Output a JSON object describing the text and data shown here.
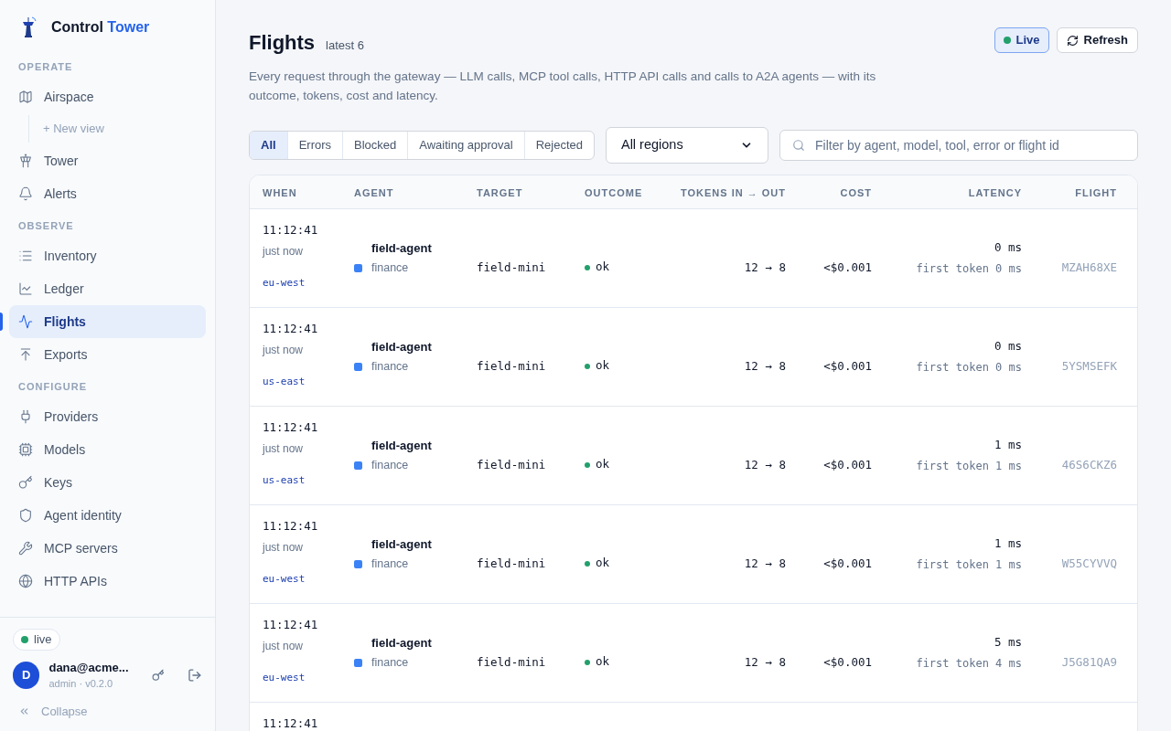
{
  "brand": {
    "first": "Control",
    "second": "Tower"
  },
  "sidebar": {
    "sections": [
      {
        "title": "OPERATE",
        "items": [
          {
            "label": "Airspace",
            "selected": false,
            "children": [
              {
                "label": "+ New view",
                "selected": false
              }
            ]
          },
          {
            "label": "Tower",
            "selected": false
          },
          {
            "label": "Alerts",
            "selected": false
          }
        ]
      },
      {
        "title": "OBSERVE",
        "items": [
          {
            "label": "Inventory",
            "selected": false
          },
          {
            "label": "Ledger",
            "selected": false
          },
          {
            "label": "Flights",
            "selected": true
          },
          {
            "label": "Exports",
            "selected": false
          }
        ]
      },
      {
        "title": "CONFIGURE",
        "items": [
          {
            "label": "Providers",
            "selected": false
          },
          {
            "label": "Models",
            "selected": false
          },
          {
            "label": "Keys",
            "selected": false
          },
          {
            "label": "Agent identity",
            "selected": false
          },
          {
            "label": "MCP servers",
            "selected": false
          },
          {
            "label": "HTTP APIs",
            "selected": false
          }
        ]
      }
    ],
    "status": {
      "label": "live",
      "color": "#22a06b"
    },
    "user": {
      "initial": "D",
      "email": "dana@acme...",
      "role": "admin · v0.2.0"
    },
    "collapse": "Collapse"
  },
  "page": {
    "title": "Flights",
    "count": "latest 6",
    "description": "Every request through the gateway — LLM calls, MCP tool calls, HTTP API calls and calls to A2A agents — with its outcome, tokens, cost and latency.",
    "live": {
      "label": "Live",
      "on": true,
      "color": "#22a06b"
    },
    "refresh": "Refresh"
  },
  "filters": [
    {
      "label": "All",
      "selected": true
    },
    {
      "label": "Errors",
      "selected": false
    },
    {
      "label": "Blocked",
      "selected": false
    },
    {
      "label": "Awaiting approval",
      "selected": false
    },
    {
      "label": "Rejected",
      "selected": false
    }
  ],
  "region": {
    "value": "All regions"
  },
  "search": {
    "placeholder": "Filter by agent, model, tool, error or flight id"
  },
  "table": {
    "columns": [
      "WHEN",
      "AGENT",
      "TARGET",
      "OUTCOME",
      "TOKENS IN → OUT",
      "COST",
      "LATENCY",
      "FLIGHT"
    ],
    "rows": [
      {
        "time": "11:12:41",
        "ago": "just now",
        "region": "eu-west",
        "agent": "field-agent",
        "team": "finance",
        "color": "#3b82f6",
        "target": "field-mini",
        "outcome": {
          "label": "ok",
          "color": "#22a06b"
        },
        "tokens": "12 → 8",
        "cost": "<$0.001",
        "latency": "0 ms",
        "first_token": "first token 0 ms",
        "flight": "MZAH68XE"
      },
      {
        "time": "11:12:41",
        "ago": "just now",
        "region": "us-east",
        "agent": "field-agent",
        "team": "finance",
        "color": "#3b82f6",
        "target": "field-mini",
        "outcome": {
          "label": "ok",
          "color": "#22a06b"
        },
        "tokens": "12 → 8",
        "cost": "<$0.001",
        "latency": "0 ms",
        "first_token": "first token 0 ms",
        "flight": "5YSMSEFK"
      },
      {
        "time": "11:12:41",
        "ago": "just now",
        "region": "us-east",
        "agent": "field-agent",
        "team": "finance",
        "color": "#3b82f6",
        "target": "field-mini",
        "outcome": {
          "label": "ok",
          "color": "#22a06b"
        },
        "tokens": "12 → 8",
        "cost": "<$0.001",
        "latency": "1 ms",
        "first_token": "first token 1 ms",
        "flight": "46S6CKZ6"
      },
      {
        "time": "11:12:41",
        "ago": "just now",
        "region": "eu-west",
        "agent": "field-agent",
        "team": "finance",
        "color": "#3b82f6",
        "target": "field-mini",
        "outcome": {
          "label": "ok",
          "color": "#22a06b"
        },
        "tokens": "12 → 8",
        "cost": "<$0.001",
        "latency": "1 ms",
        "first_token": "first token 1 ms",
        "flight": "W55CYVVQ"
      },
      {
        "time": "11:12:41",
        "ago": "just now",
        "region": "eu-west",
        "agent": "field-agent",
        "team": "finance",
        "color": "#3b82f6",
        "target": "field-mini",
        "outcome": {
          "label": "ok",
          "color": "#22a06b"
        },
        "tokens": "12 → 8",
        "cost": "<$0.001",
        "latency": "5 ms",
        "first_token": "first token 4 ms",
        "flight": "J5G81QA9"
      },
      {
        "time": "11:12:41"
      }
    ]
  }
}
